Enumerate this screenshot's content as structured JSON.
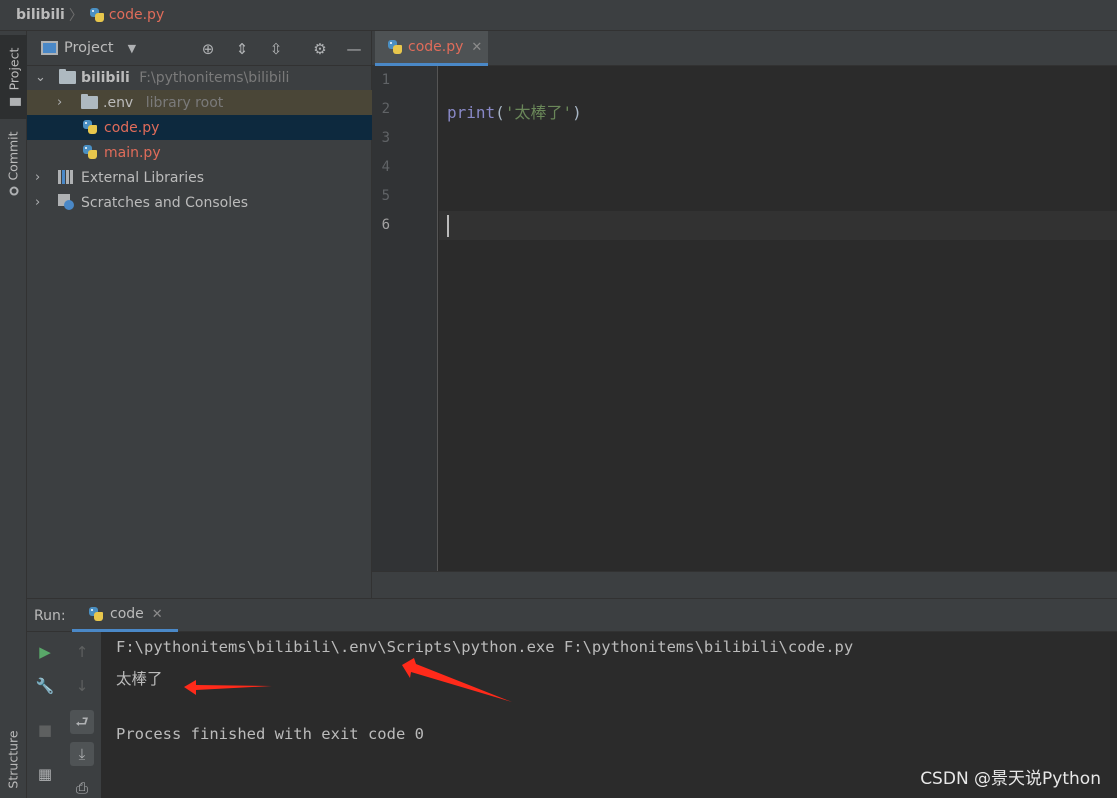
{
  "navbar": {
    "project": "bilibili",
    "file": "code.py"
  },
  "left_strip": {
    "project_tab": "Project",
    "commit_tab": "Commit",
    "structure_tab": "Structure"
  },
  "project_panel": {
    "title": "Project",
    "tree": {
      "root": {
        "name": "bilibili",
        "path": "F:\\pythonitems\\bilibili"
      },
      "env": {
        "name": ".env",
        "hint": "library root"
      },
      "code_file": "code.py",
      "main_file": "main.py",
      "external": "External Libraries",
      "scratches": "Scratches and Consoles"
    }
  },
  "editor": {
    "tab": "code.py",
    "line_numbers": [
      "1",
      "2",
      "3",
      "4",
      "5",
      "6"
    ],
    "current_line": "6",
    "code": {
      "func": "print",
      "open": "(",
      "string": "'太棒了'",
      "close": ")"
    }
  },
  "run": {
    "label": "Run:",
    "tab": "code",
    "output": {
      "command": "F:\\pythonitems\\bilibili\\.env\\Scripts\\python.exe F:\\pythonitems\\bilibili\\code.py",
      "result": "太棒了",
      "finished": "Process finished with exit code 0"
    }
  },
  "watermark": "CSDN @景天说Python",
  "colors": {
    "accent": "#4a88c7",
    "file_modified": "#e06c5a",
    "annotation": "#ff2a1a"
  }
}
